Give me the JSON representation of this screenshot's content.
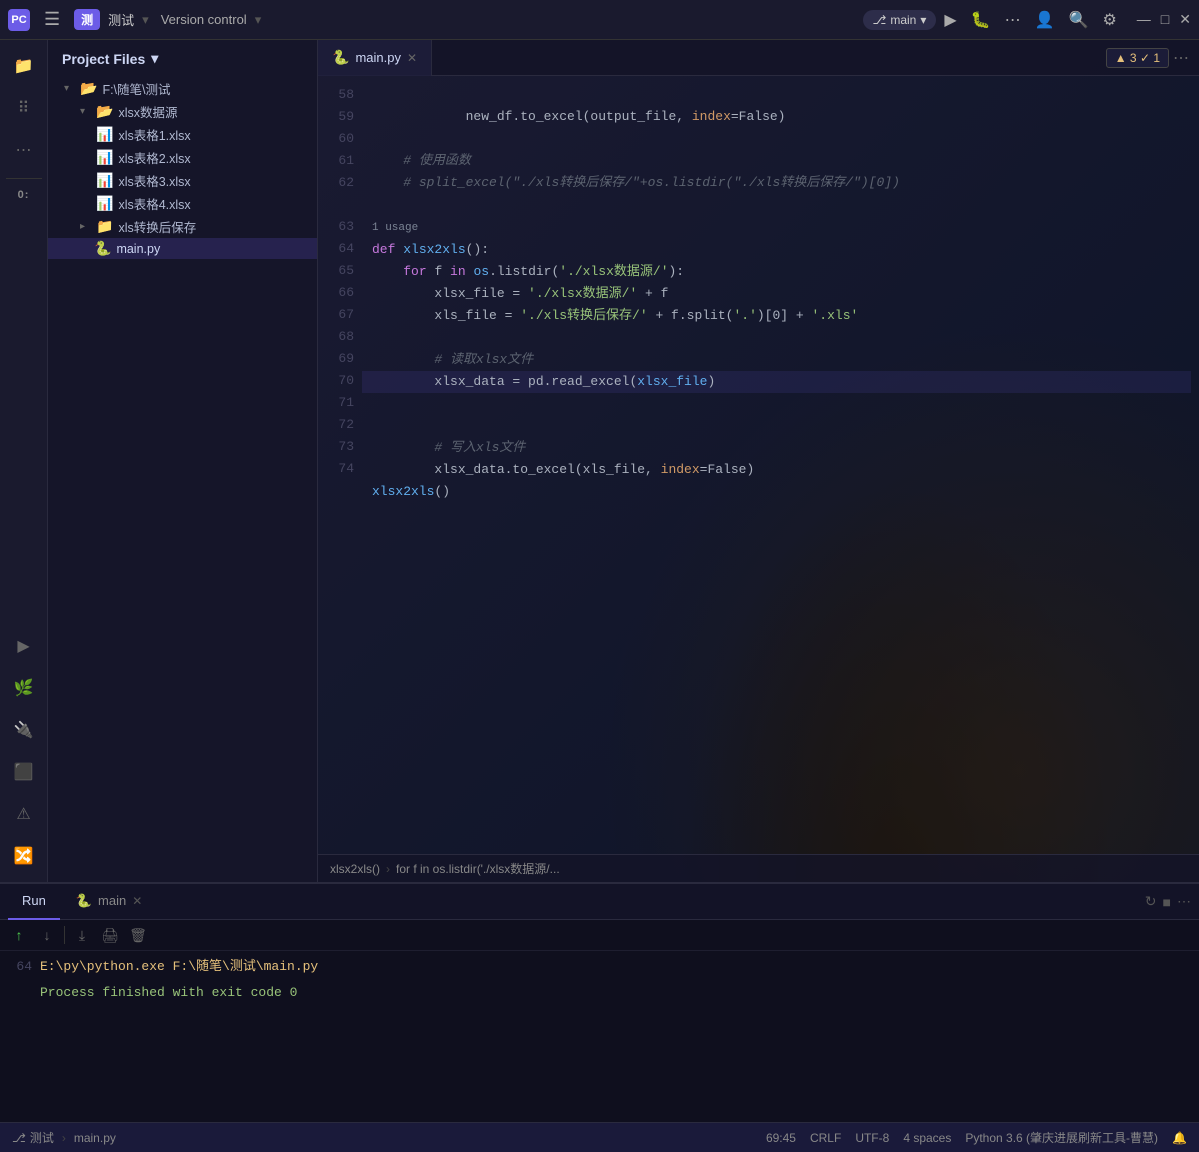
{
  "titlebar": {
    "logo": "PC",
    "hamburger": "☰",
    "project_badge": "测",
    "project_name": "测试",
    "vcs": "Version control",
    "branch": "main",
    "run_label": "▶",
    "debug_label": "🐞",
    "more_label": "⋯",
    "account_label": "👤",
    "search_label": "🔍",
    "settings_label": "⚙",
    "minimize": "—",
    "maximize": "□",
    "close": "✕"
  },
  "sidebar": {
    "title": "Project Files",
    "chevron": "▾",
    "tree": [
      {
        "indent": 0,
        "type": "folder",
        "open": true,
        "label": "F:\\随笔\\测试"
      },
      {
        "indent": 1,
        "type": "folder",
        "open": true,
        "label": "xlsx数据源"
      },
      {
        "indent": 2,
        "type": "file",
        "label": "xls表格1.xlsx"
      },
      {
        "indent": 2,
        "type": "file",
        "label": "xls表格2.xlsx"
      },
      {
        "indent": 2,
        "type": "file",
        "label": "xls表格3.xlsx"
      },
      {
        "indent": 2,
        "type": "file",
        "label": "xls表格4.xlsx"
      },
      {
        "indent": 1,
        "type": "folder",
        "open": false,
        "label": "xls转换后保存",
        "selected": false
      },
      {
        "indent": 1,
        "type": "python",
        "label": "main.py",
        "selected": true
      }
    ]
  },
  "editor": {
    "tab_file": "main.py",
    "tab_icon": "🐍",
    "breadcrumb_func": "xlsx2xls()",
    "breadcrumb_sep": "›",
    "breadcrumb_inner": "for f in os.listdir('./xlsx数据源/...",
    "error_badge": "▲ 3  ✓ 1",
    "lines": [
      {
        "num": "58",
        "tokens": [
          {
            "t": "            new_df.to_excel(output_file, ",
            "c": ""
          },
          {
            "t": "index",
            "c": "param"
          },
          {
            "t": "=False)",
            "c": ""
          }
        ]
      },
      {
        "num": "59",
        "tokens": []
      },
      {
        "num": "60",
        "tokens": [
          {
            "t": "    # 使用函数",
            "c": "cm"
          }
        ]
      },
      {
        "num": "61",
        "tokens": [
          {
            "t": "    # split_excel(\"./xls转换后保存/\"+os.listdir(\"./xls转换后保存/\")[0])",
            "c": "cm"
          }
        ]
      },
      {
        "num": "62",
        "tokens": []
      },
      {
        "num": "63",
        "tokens": [
          {
            "t": "1 usage",
            "c": "usage"
          }
        ]
      },
      {
        "num": "63",
        "tokens": [
          {
            "t": "def ",
            "c": "kw"
          },
          {
            "t": "xlsx2xls",
            "c": "fn"
          },
          {
            "t": "():",
            "c": ""
          }
        ]
      },
      {
        "num": "64",
        "tokens": [
          {
            "t": "    ",
            "c": ""
          },
          {
            "t": "for ",
            "c": "kw"
          },
          {
            "t": "f ",
            "c": ""
          },
          {
            "t": "in ",
            "c": "kw"
          },
          {
            "t": "os",
            "c": "cn"
          },
          {
            "t": ".listdir(",
            "c": ""
          },
          {
            "t": "'./xlsx数据源/'",
            "c": "str"
          },
          {
            "t": "):",
            "c": ""
          }
        ]
      },
      {
        "num": "65",
        "tokens": [
          {
            "t": "        xlsx_file = ",
            "c": ""
          },
          {
            "t": "'./xlsx数据源/' ",
            "c": "str"
          },
          {
            "t": "+ f",
            "c": ""
          }
        ]
      },
      {
        "num": "66",
        "tokens": [
          {
            "t": "        xls_file = ",
            "c": ""
          },
          {
            "t": "'./xls转换后保存/' ",
            "c": "str"
          },
          {
            "t": "+ f.split(",
            "c": ""
          },
          {
            "t": "'.'",
            "c": "str"
          },
          {
            "t": ")[0] + ",
            "c": ""
          },
          {
            "t": "'.xls'",
            "c": "str"
          }
        ]
      },
      {
        "num": "67",
        "tokens": []
      },
      {
        "num": "68",
        "tokens": [
          {
            "t": "        # 读取xlsx文件",
            "c": "cm"
          }
        ]
      },
      {
        "num": "69",
        "tokens": [
          {
            "t": "        xlsx_data = pd.read_excel(xlsx_file)",
            "c": ""
          },
          {
            "t": "xlsx_file",
            "c": "hl"
          }
        ],
        "highlight": true
      },
      {
        "num": "70",
        "tokens": []
      },
      {
        "num": "71",
        "tokens": [
          {
            "t": "        # 写入xls文件",
            "c": "cm"
          }
        ]
      },
      {
        "num": "72",
        "tokens": [
          {
            "t": "        xlsx_data.to_excel(xls_file, ",
            "c": ""
          },
          {
            "t": "index",
            "c": "param"
          },
          {
            "t": "=False)",
            "c": ""
          }
        ]
      },
      {
        "num": "73",
        "tokens": [
          {
            "t": "xlsx2xls()",
            "c": "fn"
          }
        ]
      },
      {
        "num": "74",
        "tokens": []
      }
    ]
  },
  "bottom_panel": {
    "tabs": [
      {
        "label": "Run",
        "icon": "",
        "active": true
      },
      {
        "label": "main",
        "icon": "🐍",
        "active": false
      }
    ],
    "toolbar": {
      "rerun": "↻",
      "stop": "■",
      "more": "⋯",
      "scroll_up": "↑",
      "scroll_down": "↓",
      "scroll_all": "↓↓",
      "print": "🖨",
      "trash": "🗑"
    },
    "console_lines": [
      {
        "num": "64",
        "text": "E:\\py\\python.exe F:\\随笔\\测试\\main.py",
        "style": "cmd"
      },
      {
        "num": "",
        "text": "",
        "style": ""
      },
      {
        "num": "",
        "text": "Process finished with exit code 0",
        "style": "green"
      }
    ]
  },
  "status_bar": {
    "branch_icon": "⎇",
    "branch_name": "测试",
    "file_name": "main.py",
    "position": "69:45",
    "line_ending": "CRLF",
    "encoding": "UTF-8",
    "indent": "4 spaces",
    "python_version": "Python 3.6 (肇庆进展刷新工具-曹慧)",
    "notification_icon": "🔔"
  },
  "icons": {
    "folder_open": "📂",
    "folder_closed": "📁",
    "file_xlsx": "📊",
    "file_python": "🐍",
    "chevron_right": "›",
    "chevron_down": "▾",
    "arrow_down": "↓",
    "arrow_up": "↑"
  }
}
